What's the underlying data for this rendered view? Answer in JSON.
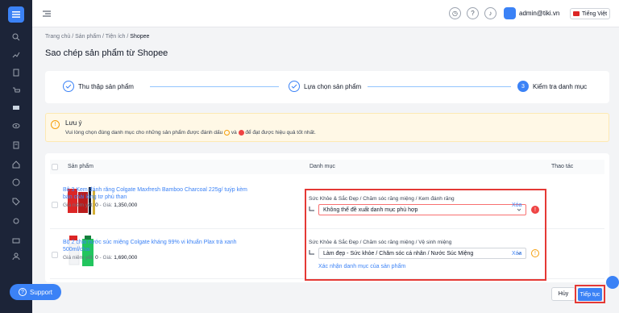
{
  "topbar": {
    "user": "admin@tiki.vn",
    "language": "Tiếng Việt"
  },
  "breadcrumb": {
    "items": [
      "Trang chủ",
      "Sản phẩm",
      "Tiện ích"
    ],
    "current": "Shopee",
    "sep": "/"
  },
  "page": {
    "title": "Sao chép sản phẩm từ Shopee"
  },
  "stepper": {
    "steps": [
      {
        "label": "Thu thập sản phẩm",
        "state": "done"
      },
      {
        "label": "Lựa chọn sản phẩm",
        "state": "done"
      },
      {
        "label": "Kiểm tra danh mục",
        "state": "active",
        "number": "3"
      }
    ]
  },
  "alert": {
    "title": "Lưu ý",
    "desc_pre": "Vui lòng chọn đúng danh mục cho những sản phẩm được đánh dấu",
    "desc_mid": "và",
    "desc_post": "để đạt được hiệu quả tốt nhất."
  },
  "table": {
    "headers": {
      "product": "Sản phẩm",
      "category": "Danh mục",
      "action": "Thao tác"
    },
    "rows": [
      {
        "name": "Bộ 3 Kem đánh răng Colgate Maxfresh Bamboo Charcoal 225g/ tuýp kèm bàn chải lông tơ phủ than",
        "price_label": "Giá niêm yết:",
        "price_listed": "0",
        "sale_label": "- Giá:",
        "price_sale": "1,350,000",
        "category_path": "Sức Khỏe & Sắc Đẹp / Chăm sóc răng miệng / Kem đánh răng",
        "select_value": "Không thể đề xuất danh mục phù hợp",
        "status": "error",
        "action": "Xóa"
      },
      {
        "name": "Bộ 2 chai nước súc miệng Colgate kháng 99% vi khuẩn Plax trà xanh 500ml/chai",
        "price_label": "Giá niêm yết:",
        "price_listed": "0",
        "sale_label": "- Giá:",
        "price_sale": "1,690,000",
        "category_path": "Sức Khỏe & Sắc Đẹp / Chăm sóc răng miệng / Vệ sinh miệng",
        "select_value": "Làm đẹp - Sức khỏe / Chăm sóc cá nhân / Nước Súc Miệng",
        "status": "warning",
        "confirm": "Xác nhận danh mục của sản phẩm",
        "action": "Xóa"
      }
    ]
  },
  "footer": {
    "cancel": "Hủy",
    "next": "Tiếp tục"
  },
  "support": {
    "label": "Support"
  },
  "colors": {
    "accent": "#3b82f6",
    "sidebar": "#1c2438",
    "error": "#ef4444",
    "warning": "#f59e0b",
    "highlight": "#e53935"
  }
}
